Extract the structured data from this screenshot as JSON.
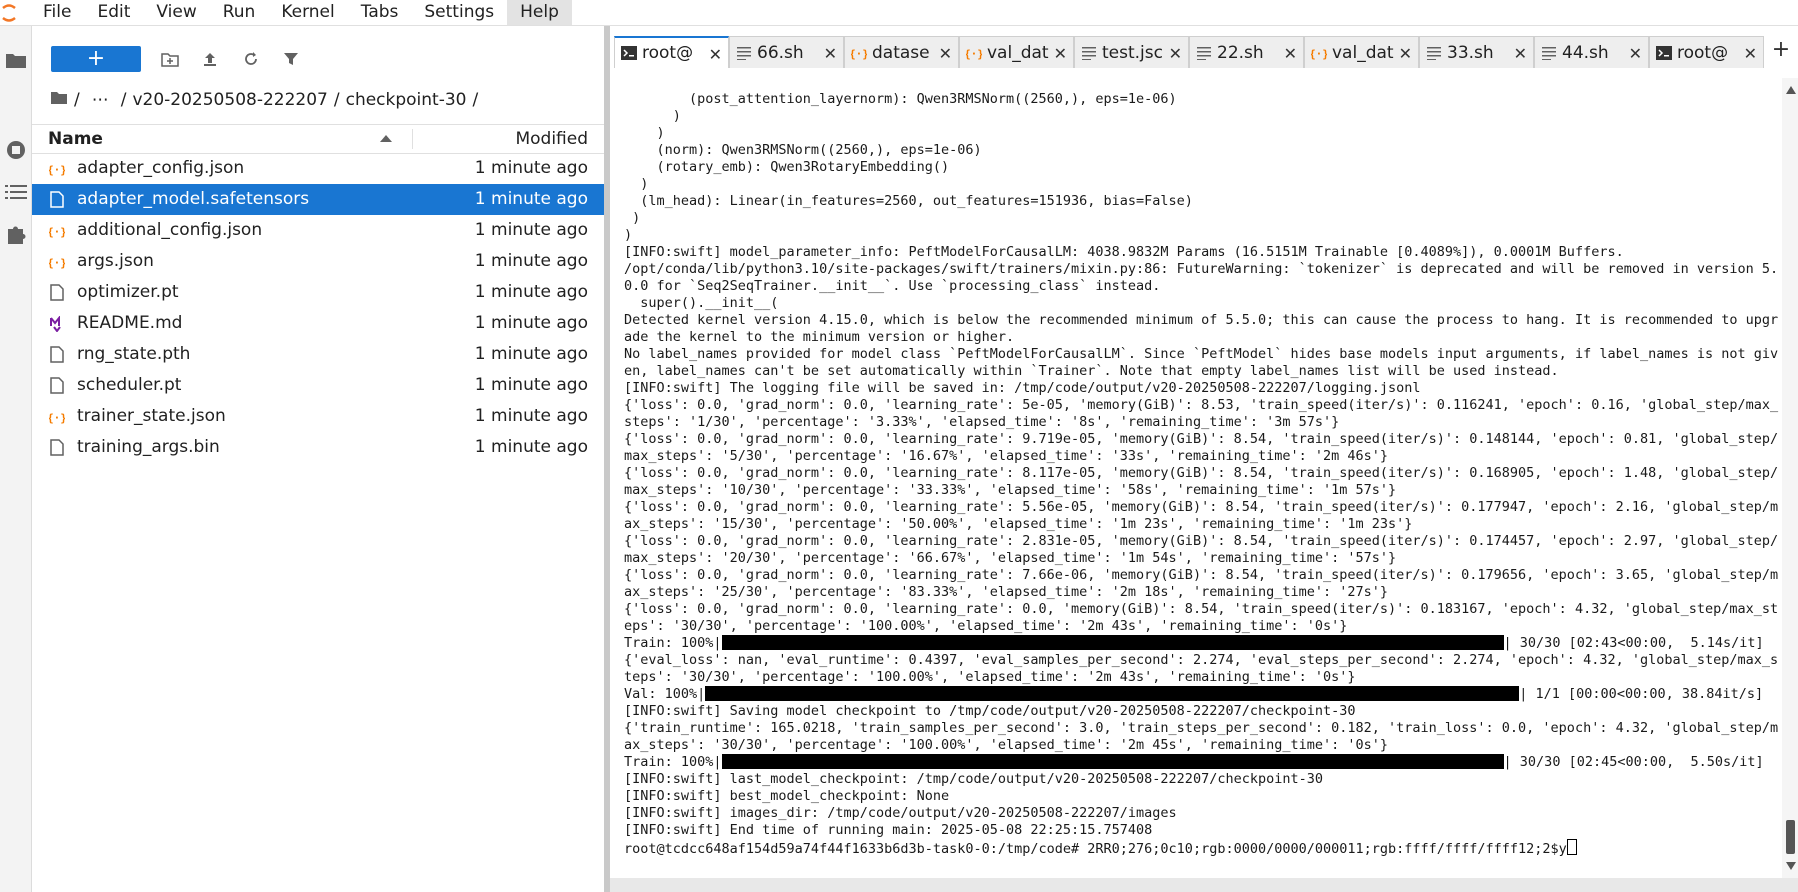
{
  "menubar": {
    "items": [
      {
        "label": "File"
      },
      {
        "label": "Edit"
      },
      {
        "label": "View"
      },
      {
        "label": "Run"
      },
      {
        "label": "Kernel"
      },
      {
        "label": "Tabs"
      },
      {
        "label": "Settings"
      },
      {
        "label": "Help"
      }
    ]
  },
  "filebrowser": {
    "new_button_label": "+",
    "breadcrumb": {
      "root_icon": "folder-icon",
      "sep1": "/",
      "ellipsis": "⋯",
      "sep2": "/",
      "folder1": "v20-20250508-222207",
      "sep3": "/",
      "folder2": "checkpoint-30",
      "sep4": "/"
    },
    "header": {
      "name": "Name",
      "modified": "Modified"
    },
    "files": [
      {
        "name": "adapter_config.json",
        "modified": "1 minute ago",
        "icon": "json-icon"
      },
      {
        "name": "adapter_model.safetensors",
        "modified": "1 minute ago",
        "icon": "file-icon"
      },
      {
        "name": "additional_config.json",
        "modified": "1 minute ago",
        "icon": "json-icon"
      },
      {
        "name": "args.json",
        "modified": "1 minute ago",
        "icon": "json-icon"
      },
      {
        "name": "optimizer.pt",
        "modified": "1 minute ago",
        "icon": "file-icon"
      },
      {
        "name": "README.md",
        "modified": "1 minute ago",
        "icon": "markdown-icon"
      },
      {
        "name": "rng_state.pth",
        "modified": "1 minute ago",
        "icon": "file-icon"
      },
      {
        "name": "scheduler.pt",
        "modified": "1 minute ago",
        "icon": "file-icon"
      },
      {
        "name": "trainer_state.json",
        "modified": "1 minute ago",
        "icon": "json-icon"
      },
      {
        "name": "training_args.bin",
        "modified": "1 minute ago",
        "icon": "file-icon"
      }
    ],
    "selected_index": 1
  },
  "tabs": [
    {
      "label": "root@",
      "icon": "terminal-icon",
      "active": true
    },
    {
      "label": "66.sh",
      "icon": "text-file-icon"
    },
    {
      "label": "datase",
      "icon": "json-icon"
    },
    {
      "label": "val_dat",
      "icon": "json-icon"
    },
    {
      "label": "test.jsc",
      "icon": "text-file-icon"
    },
    {
      "label": "22.sh",
      "icon": "text-file-icon"
    },
    {
      "label": "val_dat",
      "icon": "json-icon"
    },
    {
      "label": "33.sh",
      "icon": "text-file-icon"
    },
    {
      "label": "44.sh",
      "icon": "text-file-icon"
    },
    {
      "label": "root@",
      "icon": "terminal-icon"
    }
  ],
  "tab_close_glyph": "✕",
  "add_tab_glyph": "+",
  "terminal": {
    "lines": [
      "        (post_attention_layernorm): Qwen3RMSNorm((2560,), eps=1e-06)",
      "      )",
      "    )",
      "    (norm): Qwen3RMSNorm((2560,), eps=1e-06)",
      "    (rotary_emb): Qwen3RotaryEmbedding()",
      "  )",
      "  (lm_head): Linear(in_features=2560, out_features=151936, bias=False)",
      " )",
      ")",
      "[INFO:swift] model_parameter_info: PeftModelForCausalLM: 4038.9832M Params (16.5151M Trainable [0.4089%]), 0.0001M Buffers.",
      "/opt/conda/lib/python3.10/site-packages/swift/trainers/mixin.py:86: FutureWarning: `tokenizer` is deprecated and will be removed in version 5.",
      "0.0 for `Seq2SeqTrainer.__init__`. Use `processing_class` instead.",
      "  super().__init__(",
      "Detected kernel version 4.15.0, which is below the recommended minimum of 5.5.0; this can cause the process to hang. It is recommended to upgr",
      "ade the kernel to the minimum version or higher.",
      "No label_names provided for model class `PeftModelForCausalLM`. Since `PeftModel` hides base models input arguments, if label_names is not giv",
      "en, label_names can't be set automatically within `Trainer`. Note that empty label_names list will be used instead.",
      "[INFO:swift] The logging file will be saved in: /tmp/code/output/v20-20250508-222207/logging.jsonl",
      "{'loss': 0.0, 'grad_norm': 0.0, 'learning_rate': 5e-05, 'memory(GiB)': 8.53, 'train_speed(iter/s)': 0.116241, 'epoch': 0.16, 'global_step/max_",
      "steps': '1/30', 'percentage': '3.33%', 'elapsed_time': '8s', 'remaining_time': '3m 57s'}",
      "{'loss': 0.0, 'grad_norm': 0.0, 'learning_rate': 9.719e-05, 'memory(GiB)': 8.54, 'train_speed(iter/s)': 0.148144, 'epoch': 0.81, 'global_step/",
      "max_steps': '5/30', 'percentage': '16.67%', 'elapsed_time': '33s', 'remaining_time': '2m 46s'}",
      "{'loss': 0.0, 'grad_norm': 0.0, 'learning_rate': 8.117e-05, 'memory(GiB)': 8.54, 'train_speed(iter/s)': 0.168905, 'epoch': 1.48, 'global_step/",
      "max_steps': '10/30', 'percentage': '33.33%', 'elapsed_time': '58s', 'remaining_time': '1m 57s'}",
      "{'loss': 0.0, 'grad_norm': 0.0, 'learning_rate': 5.56e-05, 'memory(GiB)': 8.54, 'train_speed(iter/s)': 0.177947, 'epoch': 2.16, 'global_step/m",
      "ax_steps': '15/30', 'percentage': '50.00%', 'elapsed_time': '1m 23s', 'remaining_time': '1m 23s'}",
      "{'loss': 0.0, 'grad_norm': 0.0, 'learning_rate': 2.831e-05, 'memory(GiB)': 8.54, 'train_speed(iter/s)': 0.174457, 'epoch': 2.97, 'global_step/",
      "max_steps': '20/30', 'percentage': '66.67%', 'elapsed_time': '1m 54s', 'remaining_time': '57s'}",
      "{'loss': 0.0, 'grad_norm': 0.0, 'learning_rate': 7.66e-06, 'memory(GiB)': 8.54, 'train_speed(iter/s)': 0.179656, 'epoch': 3.65, 'global_step/m",
      "ax_steps': '25/30', 'percentage': '83.33%', 'elapsed_time': '2m 18s', 'remaining_time': '27s'}",
      "{'loss': 0.0, 'grad_norm': 0.0, 'learning_rate': 0.0, 'memory(GiB)': 8.54, 'train_speed(iter/s)': 0.183167, 'epoch': 4.32, 'global_step/max_st",
      "eps': '30/30', 'percentage': '100.00%', 'elapsed_time': '2m 43s', 'remaining_time': '0s'}"
    ],
    "progress_train1": {
      "prefix": "Train: 100%|",
      "suffix": "| 30/30 [02:43<00:00,  5.14s/it]",
      "fraction": 1.0
    },
    "lines_mid": [
      "{'eval_loss': nan, 'eval_runtime': 0.4397, 'eval_samples_per_second': 2.274, 'eval_steps_per_second': 2.274, 'epoch': 4.32, 'global_step/max_s",
      "teps': '30/30', 'percentage': '100.00%', 'elapsed_time': '2m 43s', 'remaining_time': '0s'}"
    ],
    "progress_val": {
      "prefix": "Val: 100%|",
      "suffix": "| 1/1 [00:00<00:00, 38.84it/s]",
      "fraction": 1.0
    },
    "lines_mid2": [
      "[INFO:swift] Saving model checkpoint to /tmp/code/output/v20-20250508-222207/checkpoint-30",
      "{'train_runtime': 165.0218, 'train_samples_per_second': 3.0, 'train_steps_per_second': 0.182, 'train_loss': 0.0, 'epoch': 4.32, 'global_step/m",
      "ax_steps': '30/30', 'percentage': '100.00%', 'elapsed_time': '2m 45s', 'remaining_time': '0s'}"
    ],
    "progress_train2": {
      "prefix": "Train: 100%|",
      "suffix": "| 30/30 [02:45<00:00,  5.50s/it]",
      "fraction": 1.0
    },
    "lines_end": [
      "[INFO:swift] last_model_checkpoint: /tmp/code/output/v20-20250508-222207/checkpoint-30",
      "[INFO:swift] best_model_checkpoint: None",
      "[INFO:swift] images_dir: /tmp/code/output/v20-20250508-222207/images",
      "[INFO:swift] End time of running main: 2025-05-08 22:25:15.757408"
    ],
    "prompt_line": "root@tcdcc648af154d59a74f44f1633b6d3b-task0-0:/tmp/code# 2RR0;276;0c10;rgb:0000/0000/000011;rgb:ffff/ffff/ffff12;2$y"
  },
  "colors": {
    "accent": "#1976d2",
    "json_icon": "#f57c00",
    "markdown_icon": "#7b1fa2"
  }
}
